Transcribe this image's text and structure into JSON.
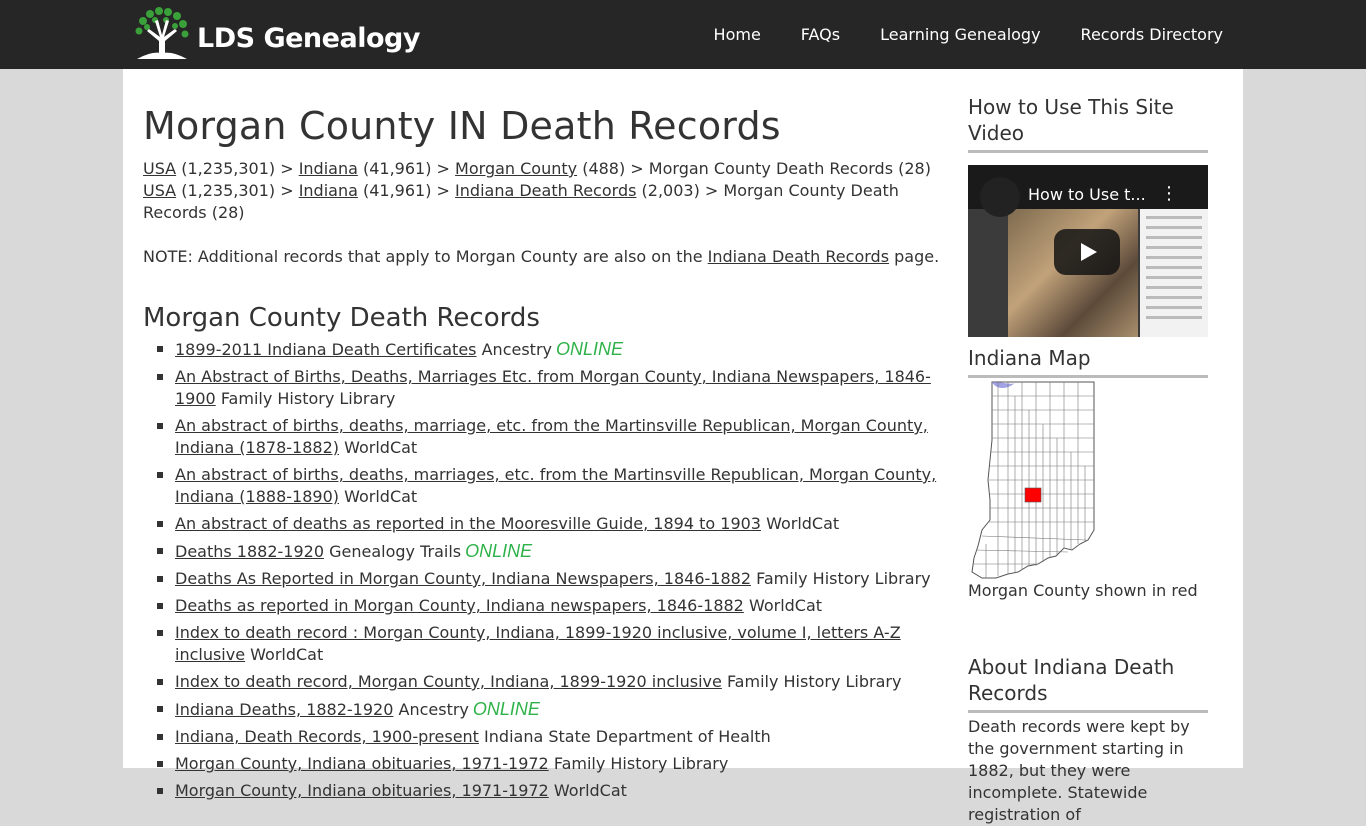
{
  "header": {
    "logo_text": "LDS Genealogy",
    "nav": [
      "Home",
      "FAQs",
      "Learning Genealogy",
      "Records Directory"
    ]
  },
  "main": {
    "title": "Morgan County IN Death Records",
    "breadcrumb1": {
      "usa": "USA",
      "usa_count": " (1,235,301) > ",
      "indiana": "Indiana",
      "indiana_count": " (41,961) > ",
      "county": "Morgan County",
      "county_count": " (488) > Morgan County Death Records (28)"
    },
    "breadcrumb2": {
      "usa": "USA",
      "usa_count": " (1,235,301) > ",
      "indiana": "Indiana",
      "indiana_count": " (41,961) > ",
      "records": "Indiana Death Records",
      "records_count": " (2,003) > Morgan County Death Records (28)"
    },
    "note": {
      "prefix": "NOTE: Additional records that apply to Morgan County are also on the ",
      "link": "Indiana Death Records",
      "suffix": " page."
    },
    "section_title": "Morgan County Death Records",
    "records": [
      {
        "link": "1899-2011 Indiana Death Certificates",
        "source": "Ancestry",
        "online": "ONLINE"
      },
      {
        "link": "An Abstract of Births, Deaths, Marriages Etc. from Morgan County, Indiana Newspapers, 1846-1900",
        "source": "Family History Library",
        "online": ""
      },
      {
        "link": "An abstract of births, deaths, marriage, etc. from the Martinsville Republican, Morgan County, Indiana (1878-1882)",
        "source": "WorldCat",
        "online": ""
      },
      {
        "link": "An abstract of births, deaths, marriages, etc. from the Martinsville Republican, Morgan County, Indiana (1888-1890)",
        "source": "WorldCat",
        "online": ""
      },
      {
        "link": "An abstract of deaths as reported in the Mooresville Guide, 1894 to 1903",
        "source": "WorldCat",
        "online": ""
      },
      {
        "link": "Deaths 1882-1920",
        "source": "Genealogy Trails",
        "online": "ONLINE"
      },
      {
        "link": "Deaths As Reported in Morgan County, Indiana Newspapers, 1846-1882",
        "source": "Family History Library",
        "online": ""
      },
      {
        "link": "Deaths as reported in Morgan County, Indiana newspapers, 1846-1882",
        "source": "WorldCat",
        "online": ""
      },
      {
        "link": "Index to death record : Morgan County, Indiana, 1899-1920 inclusive, volume I, letters A-Z inclusive",
        "source": "WorldCat",
        "online": ""
      },
      {
        "link": "Index to death record, Morgan County, Indiana, 1899-1920 inclusive",
        "source": "Family History Library",
        "online": ""
      },
      {
        "link": "Indiana Deaths, 1882-1920",
        "source": "Ancestry",
        "online": "ONLINE"
      },
      {
        "link": "Indiana, Death Records, 1900-present",
        "source": "Indiana State Department of Health",
        "online": ""
      },
      {
        "link": "Morgan County, Indiana obituaries, 1971-1972",
        "source": "Family History Library",
        "online": ""
      },
      {
        "link": "Morgan County, Indiana obituaries, 1971-1972",
        "source": "WorldCat",
        "online": ""
      }
    ]
  },
  "sidebar": {
    "video_heading": "How to Use This Site Video",
    "video_title": "How to Use t...",
    "map_heading": "Indiana Map",
    "map_caption": "Morgan County shown in red",
    "about_heading": "About Indiana Death Records",
    "about_text": "Death records were kept by the government starting in 1882, but they were incomplete. Statewide registration of"
  },
  "colors": {
    "header_bg": "#262626",
    "online_green": "#2fb24a",
    "county_highlight": "#ff0000"
  }
}
